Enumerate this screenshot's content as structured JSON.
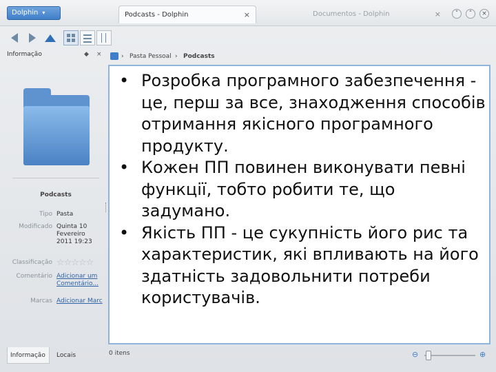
{
  "titlebar": {
    "menu_label": "Dolphin",
    "menu_caret": "▾",
    "active_tab": "Podcasts - Dolphin",
    "inactive_tab": "Documentos - Dolphin",
    "close_glyph": "×"
  },
  "toolbar": {
    "icons": [
      "back-arrow-icon",
      "forward-arrow-icon",
      "up-arrow-icon",
      "icons-view-icon",
      "details-view-icon",
      "columns-view-icon"
    ]
  },
  "info_panel": {
    "header": "Informação",
    "title": "Podcasts",
    "properties": [
      {
        "label": "Tipo",
        "value": "Pasta"
      },
      {
        "label": "Modificado",
        "value": "Quinta 10 Fevereiro 2011 19:23"
      },
      {
        "label": "Classificação",
        "value": "☆☆☆☆☆"
      },
      {
        "label": "Comentário",
        "value": "Adicionar um Comentário..."
      },
      {
        "label": "Marcas",
        "value": "Adicionar Marc"
      }
    ],
    "tabs": [
      "Informação",
      "Locais"
    ]
  },
  "breadcrumb": {
    "items": [
      "Pasta Pessoal",
      "Podcasts"
    ],
    "separator": "›"
  },
  "content": {
    "bullet": "•",
    "items": [
      "Розробка програмного забезпечення - це, перш за все, знаходження способів отримання якісного програмного продукту.",
      "Кожен ПП повинен виконувати певні функції, тобто робити те, що задумано.",
      "Якість ПП - це сукупність його рис та характеристик, які впливають на його здатність задовольнити потреби користувачів."
    ]
  },
  "status": {
    "items_label": "0 itens",
    "zoom_level": 0.08
  },
  "colors": {
    "accent": "#3f7fc9",
    "content_border": "#8fb4dc"
  }
}
